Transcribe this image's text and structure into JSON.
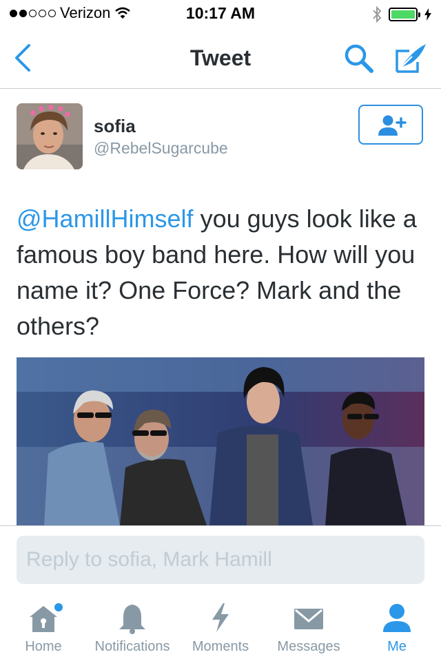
{
  "status_bar": {
    "carrier": "Verizon",
    "time": "10:17 AM",
    "signal_bars": 2,
    "battery_level": 1.0,
    "battery_color": "#4cd964"
  },
  "nav": {
    "title": "Tweet",
    "icons": [
      "chevron-left-icon",
      "search-icon",
      "compose-icon"
    ],
    "accent": "#2b97e8"
  },
  "tweet": {
    "author_name": "sofia",
    "author_handle": "@RebelSugarcube",
    "mention": "@HamillHimself",
    "text": " you guys look like a famous boy band here. How will you name it? One Force? Mark and the others?",
    "follow_icon": "follow-user-icon"
  },
  "reply": {
    "placeholder": "Reply to sofia, Mark Hamill"
  },
  "tabs": [
    {
      "label": "Home",
      "icon": "home-icon",
      "notification_dot": true
    },
    {
      "label": "Notifications",
      "icon": "bell-icon"
    },
    {
      "label": "Moments",
      "icon": "lightning-icon"
    },
    {
      "label": "Messages",
      "icon": "envelope-icon"
    },
    {
      "label": "Me",
      "icon": "person-icon",
      "active": true
    }
  ]
}
